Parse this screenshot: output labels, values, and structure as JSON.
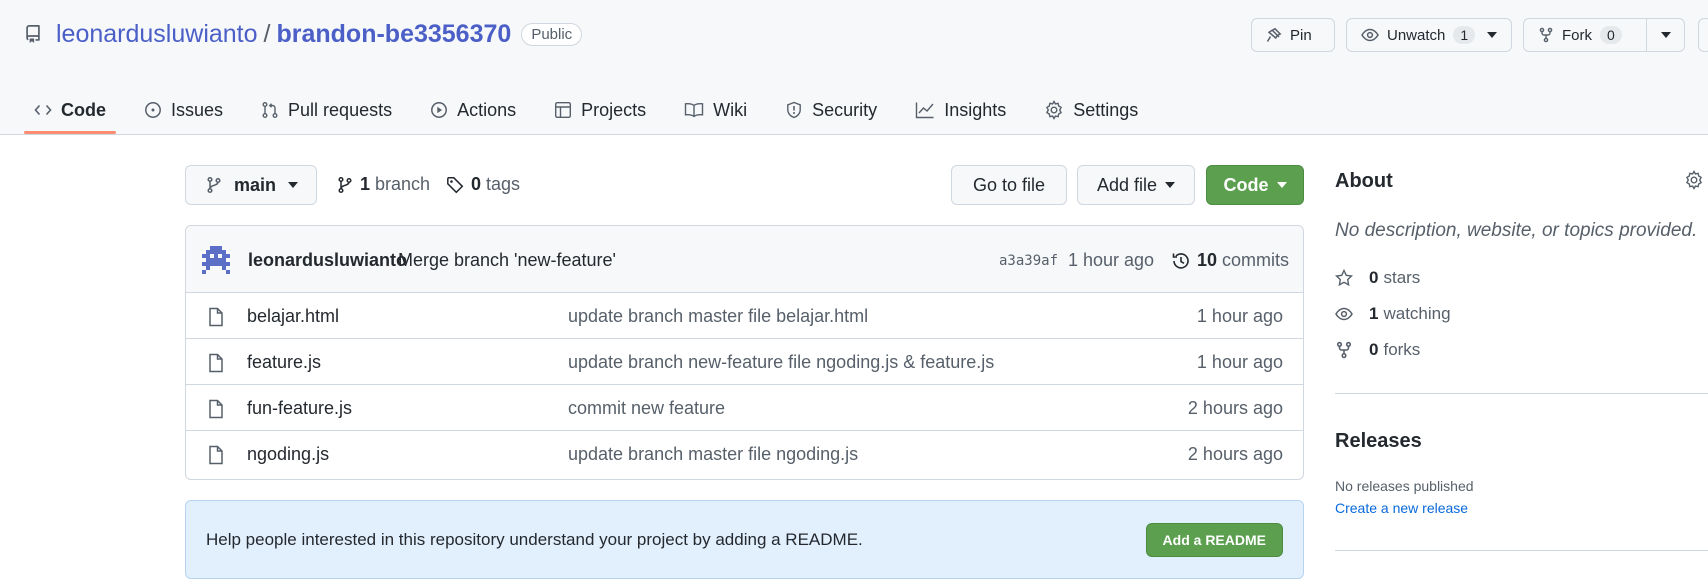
{
  "repo": {
    "owner": "leonardusluwianto",
    "separator": "/",
    "name": "brandon-be3356370",
    "visibility": "Public"
  },
  "actions": {
    "pin_label": "Pin",
    "watch_label": "Unwatch",
    "watch_count": "1",
    "fork_label": "Fork",
    "fork_count": "0"
  },
  "tabs": [
    {
      "label": "Code",
      "icon": "code-icon",
      "active": true
    },
    {
      "label": "Issues",
      "icon": "issue-icon"
    },
    {
      "label": "Pull requests",
      "icon": "pull-request-icon"
    },
    {
      "label": "Actions",
      "icon": "play-icon"
    },
    {
      "label": "Projects",
      "icon": "table-icon"
    },
    {
      "label": "Wiki",
      "icon": "book-icon"
    },
    {
      "label": "Security",
      "icon": "shield-icon"
    },
    {
      "label": "Insights",
      "icon": "graph-icon"
    },
    {
      "label": "Settings",
      "icon": "gear-icon"
    }
  ],
  "toolbar": {
    "branch": "main",
    "branch_count": "1",
    "branch_word": "branch",
    "tag_count": "0",
    "tag_word": "tags",
    "go_to_file": "Go to file",
    "add_file": "Add file",
    "code": "Code"
  },
  "last_commit": {
    "author": "leonardusluwianto",
    "message": "Merge branch 'new-feature'",
    "sha": "a3a39af",
    "time": "1 hour ago",
    "count": "10",
    "count_word": "commits"
  },
  "files": [
    {
      "name": "belajar.html",
      "message": "update branch master file belajar.html",
      "time": "1 hour ago"
    },
    {
      "name": "feature.js",
      "message": "update branch new-feature file ngoding.js & feature.js",
      "time": "1 hour ago"
    },
    {
      "name": "fun-feature.js",
      "message": "commit new feature",
      "time": "2 hours ago"
    },
    {
      "name": "ngoding.js",
      "message": "update branch master file ngoding.js",
      "time": "2 hours ago"
    }
  ],
  "readme": {
    "text": "Help people interested in this repository understand your project by adding a README.",
    "button": "Add a README"
  },
  "about": {
    "title": "About",
    "description": "No description, website, or topics provided.",
    "stars_count": "0",
    "stars_word": "stars",
    "watching_count": "1",
    "watching_word": "watching",
    "forks_count": "0",
    "forks_word": "forks"
  },
  "releases": {
    "title": "Releases",
    "none_text": "No releases published",
    "create_link": "Create a new release"
  },
  "colors": {
    "link_blue": "#4b5fc7",
    "primary_green": "#5b9f4f",
    "active_tab_underline": "#fd8c73"
  }
}
